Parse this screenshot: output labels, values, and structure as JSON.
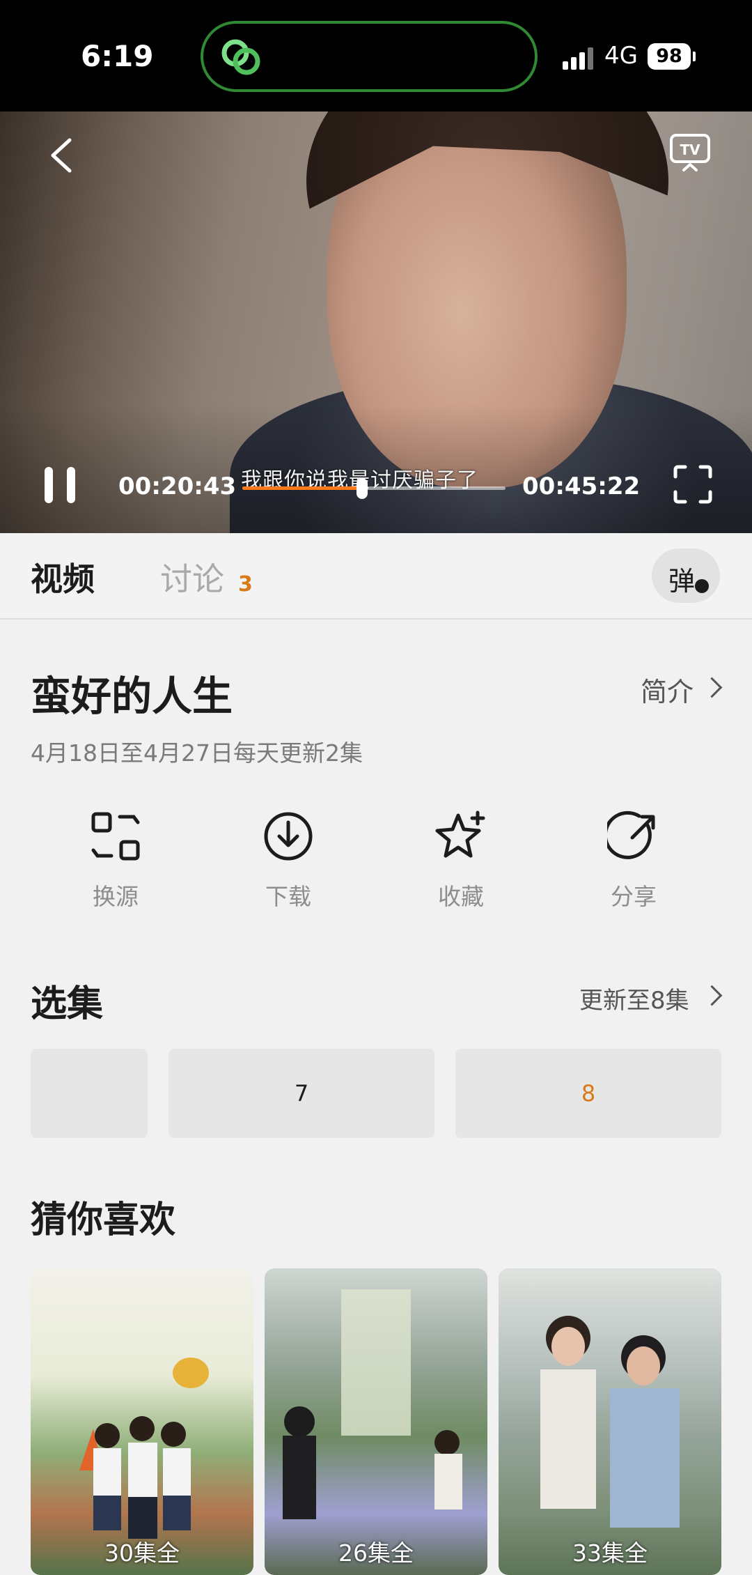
{
  "status_bar": {
    "time": "6:19",
    "network": "4G",
    "battery": "98"
  },
  "player": {
    "current_time": "00:20:43",
    "subtitle": "我跟你说我最讨厌骗子了",
    "duration": "00:45:22",
    "progress": 0.456
  },
  "tabs": {
    "video": "视频",
    "discussion": "讨论",
    "discussion_count": "3",
    "danmaku": "弹"
  },
  "show": {
    "title": "蛮好的人生",
    "intro_link": "简介",
    "schedule": "4月18日至4月27日每天更新2集"
  },
  "actions": [
    {
      "label": "换源",
      "icon": "switch-source-icon"
    },
    {
      "label": "下载",
      "icon": "download-icon"
    },
    {
      "label": "收藏",
      "icon": "favorite-star-icon"
    },
    {
      "label": "分享",
      "icon": "share-icon"
    }
  ],
  "episodes": {
    "title": "选集",
    "update_link": "更新至8集",
    "items": [
      "",
      "7",
      "8"
    ],
    "active_color": "#d97a18"
  },
  "recommend": {
    "title": "猜你喜欢",
    "items": [
      {
        "caption": "30集全"
      },
      {
        "caption": "26集全"
      },
      {
        "caption": "33集全"
      }
    ]
  }
}
